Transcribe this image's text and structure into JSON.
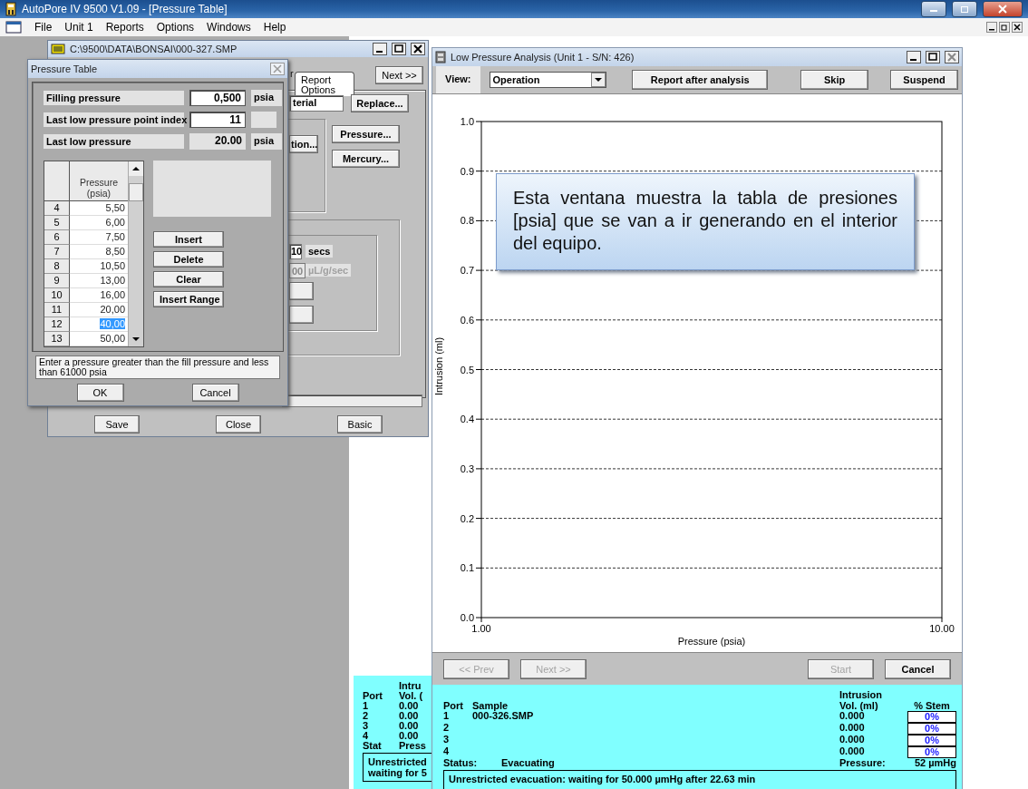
{
  "app": {
    "title": "AutoPore IV 9500 V1.09 - [Pressure Table]",
    "menu": [
      "File",
      "Unit 1",
      "Reports",
      "Options",
      "Windows",
      "Help"
    ]
  },
  "status_window": {
    "header_1": "Intru",
    "port_label": "Port",
    "header_2": "Vol. (",
    "rows": [
      {
        "port": "1",
        "volume": "0.00"
      },
      {
        "port": "2",
        "volume": "0.00"
      },
      {
        "port": "3",
        "volume": "0.00"
      },
      {
        "port": "4",
        "volume": "0.00"
      }
    ],
    "status_label": "Stat",
    "pressure_label": "Press",
    "message": [
      "Unrestricted",
      "waiting for 5"
    ]
  },
  "sample_window": {
    "title": "C:\\9500\\DATA\\BONSAI\\000-327.SMP",
    "tab_fragment": "r",
    "tab": "Report Options",
    "next_button": "Next >>",
    "material_field": "terial",
    "replace_button": "Replace...",
    "method_button": "tion...",
    "pressure_button": "Pressure...",
    "mercury_button": "Mercury...",
    "time_field": "10",
    "time_unit": "secs",
    "rate_field": "00",
    "rate_unit": "µL/g/sec",
    "buttons": [
      "Save",
      "Close",
      "Basic"
    ]
  },
  "pressure_table": {
    "title": "Pressure Table",
    "fields": [
      {
        "label": "Filling pressure",
        "value": "0,500",
        "unit": "psia",
        "kind": "input"
      },
      {
        "label": "Last low pressure point index",
        "value": "11",
        "kind": "input"
      },
      {
        "label": "Last low pressure",
        "value": "20.00",
        "unit": "psia",
        "kind": "readout"
      }
    ],
    "column": "Pressure (psia)",
    "rows": [
      {
        "index": "4",
        "pressure": "5,50",
        "selected": false
      },
      {
        "index": "5",
        "pressure": "6,00",
        "selected": false
      },
      {
        "index": "6",
        "pressure": "7,50",
        "selected": false
      },
      {
        "index": "7",
        "pressure": "8,50",
        "selected": false
      },
      {
        "index": "8",
        "pressure": "10,50",
        "selected": false
      },
      {
        "index": "9",
        "pressure": "13,00",
        "selected": false
      },
      {
        "index": "10",
        "pressure": "16,00",
        "selected": false
      },
      {
        "index": "11",
        "pressure": "20,00",
        "selected": false
      },
      {
        "index": "12",
        "pressure": "40,00",
        "selected": true
      },
      {
        "index": "13",
        "pressure": "50,00",
        "selected": false
      }
    ],
    "actions": [
      "Insert",
      "Delete",
      "Clear",
      "Insert Range"
    ],
    "hint": "Enter a pressure greater than the fill pressure and less than 61000 psia",
    "buttons": [
      "OK",
      "Cancel"
    ]
  },
  "analysis_window": {
    "title": "Low Pressure Analysis (Unit 1 - S/N: 426)",
    "view_label": "View:",
    "view_value": "Operation",
    "toolbar_buttons": [
      "Report after analysis",
      "Skip",
      "Suspend"
    ],
    "chart_data": {
      "type": "line",
      "grid": true,
      "xlabel": "Pressure (psia)",
      "ylabel": "Intrusion (ml)",
      "xlim": [
        1,
        10
      ],
      "ylim": [
        0,
        1
      ],
      "xticks": [
        {
          "value": 1,
          "label": "1.00"
        },
        {
          "value": 10,
          "label": "10.00"
        }
      ],
      "yticks": [
        {
          "value": 0,
          "label": "0.0"
        },
        {
          "value": 0.1,
          "label": "0.1"
        },
        {
          "value": 0.2,
          "label": "0.2"
        },
        {
          "value": 0.3,
          "label": "0.3"
        },
        {
          "value": 0.4,
          "label": "0.4"
        },
        {
          "value": 0.5,
          "label": "0.5"
        },
        {
          "value": 0.6,
          "label": "0.6"
        },
        {
          "value": 0.7,
          "label": "0.7"
        },
        {
          "value": 0.8,
          "label": "0.8"
        },
        {
          "value": 0.9,
          "label": "0.9"
        },
        {
          "value": 1,
          "label": "1.0"
        }
      ]
    },
    "callout": "Esta ventana muestra la tabla de presiones [psia] que se van a ir generando en el interior del equipo.",
    "nav_buttons": [
      {
        "label": "<< Prev",
        "disabled": true
      },
      {
        "label": "Next >>",
        "disabled": true
      },
      {
        "label": "Start",
        "disabled": true
      },
      {
        "label": "Cancel",
        "disabled": false
      }
    ],
    "panel": {
      "columns": [
        "Port",
        "Sample",
        "Intrusion\nVol. (ml)",
        "% Stem"
      ],
      "rows": [
        {
          "port": "1",
          "sample": "000-326.SMP",
          "volume": "0.000",
          "stem": "0%"
        },
        {
          "port": "2",
          "volume": "0.000",
          "stem": "0%"
        },
        {
          "port": "3",
          "volume": "0.000",
          "stem": "0%"
        },
        {
          "port": "4",
          "volume": "0.000",
          "stem": "0%"
        }
      ],
      "status_label": "Status:",
      "status": "Evacuating",
      "pressure_label": "Pressure:",
      "pressure": "52 µmHg",
      "message": "Unrestricted evacuation: waiting for 50.000 µmHg after 22.63 min"
    }
  }
}
